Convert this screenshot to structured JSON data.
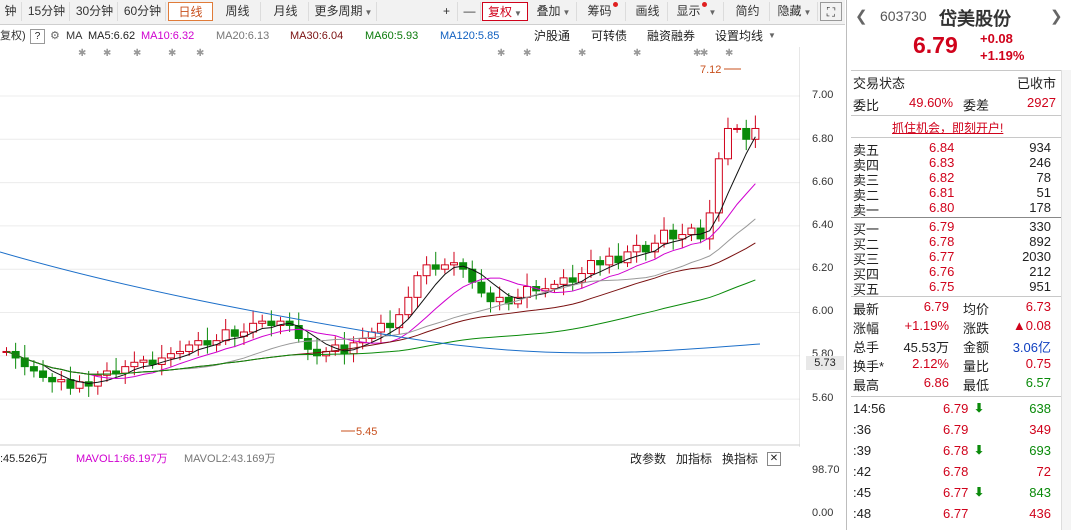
{
  "toolbar": {
    "items": [
      "钟",
      "15分钟",
      "30分钟",
      "60分钟",
      "日线",
      "周线",
      "月线",
      "更多周期",
      "+",
      "—",
      "复权",
      "叠加",
      "筹码",
      "画线",
      "显示",
      "简约",
      "隐藏"
    ]
  },
  "ma_line": {
    "prefix": "复权)",
    "ma": "MA",
    "ma5": "MA5:6.62",
    "ma10": "MA10:6.32",
    "ma20": "MA20:6.13",
    "ma30": "MA30:6.04",
    "ma60": "MA60:5.93",
    "ma120": "MA120:5.85",
    "hgt": "沪股通",
    "convert": "可转债",
    "margin": "融资融券",
    "setting": "设置均线"
  },
  "chart": {
    "y_ticks": [
      "7.00",
      "6.80",
      "6.60",
      "6.40",
      "6.20",
      "6.00",
      "5.80",
      "5.60"
    ],
    "current_price_tag": "5.73",
    "high_marker": "7.12",
    "low_marker": "5.45"
  },
  "volume": {
    "vol_label": ":45.526万",
    "mavol1": "MAVOL1:66.197万",
    "mavol2": "MAVOL2:43.169万",
    "change_param": "改参数",
    "add_indicator": "加指标",
    "switch_indicator": "换指标",
    "y_top": "98.70",
    "y_bottom": "0.00",
    "bottom_cut": "改参数  加指标  换指标"
  },
  "quote": {
    "code": "603730",
    "name": "岱美股份",
    "price": "6.79",
    "change": "+0.08",
    "change_pct": "+1.19%",
    "status_label": "交易状态",
    "status_value": "已收市",
    "weibi_label": "委比",
    "weibi_value": "49.60%",
    "weicha_label": "委差",
    "weicha_value": "2927",
    "promo": "抓住机会，即刻开户!",
    "sell": [
      {
        "label": "卖五",
        "price": "6.84",
        "vol": "934"
      },
      {
        "label": "卖四",
        "price": "6.83",
        "vol": "246"
      },
      {
        "label": "卖三",
        "price": "6.82",
        "vol": "78"
      },
      {
        "label": "卖二",
        "price": "6.81",
        "vol": "51"
      },
      {
        "label": "卖一",
        "price": "6.80",
        "vol": "178"
      }
    ],
    "buy": [
      {
        "label": "买一",
        "price": "6.79",
        "vol": "330"
      },
      {
        "label": "买二",
        "price": "6.78",
        "vol": "892"
      },
      {
        "label": "买三",
        "price": "6.77",
        "vol": "2030"
      },
      {
        "label": "买四",
        "price": "6.76",
        "vol": "212"
      },
      {
        "label": "买五",
        "price": "6.75",
        "vol": "951"
      }
    ],
    "stats": [
      {
        "l1": "最新",
        "v1": "6.79",
        "l2": "均价",
        "v2": "6.73"
      },
      {
        "l1": "涨幅",
        "v1": "+1.19%",
        "l2": "涨跌",
        "v2": "▲0.08"
      },
      {
        "l1": "总手",
        "v1": "45.53万",
        "l2": "金额",
        "v2": "3.06亿"
      },
      {
        "l1": "换手*",
        "v1": "2.12%",
        "l2": "量比",
        "v2": "0.75"
      },
      {
        "l1": "最高",
        "v1": "6.86",
        "l2": "最低",
        "v2": "6.57"
      }
    ],
    "ticks": [
      {
        "t": "14:56",
        "p": "6.79",
        "v": "638"
      },
      {
        "t": ":36",
        "p": "6.79",
        "v": "349"
      },
      {
        "t": ":39",
        "p": "6.78",
        "v": "693"
      },
      {
        "t": ":42",
        "p": "6.78",
        "v": "72"
      },
      {
        "t": ":45",
        "p": "6.77",
        "v": "843"
      },
      {
        "t": ":48",
        "p": "6.77",
        "v": "436"
      }
    ]
  },
  "colors": {
    "up": "#d0021b",
    "down": "#0a8a0a",
    "accent": "#e07b39"
  }
}
